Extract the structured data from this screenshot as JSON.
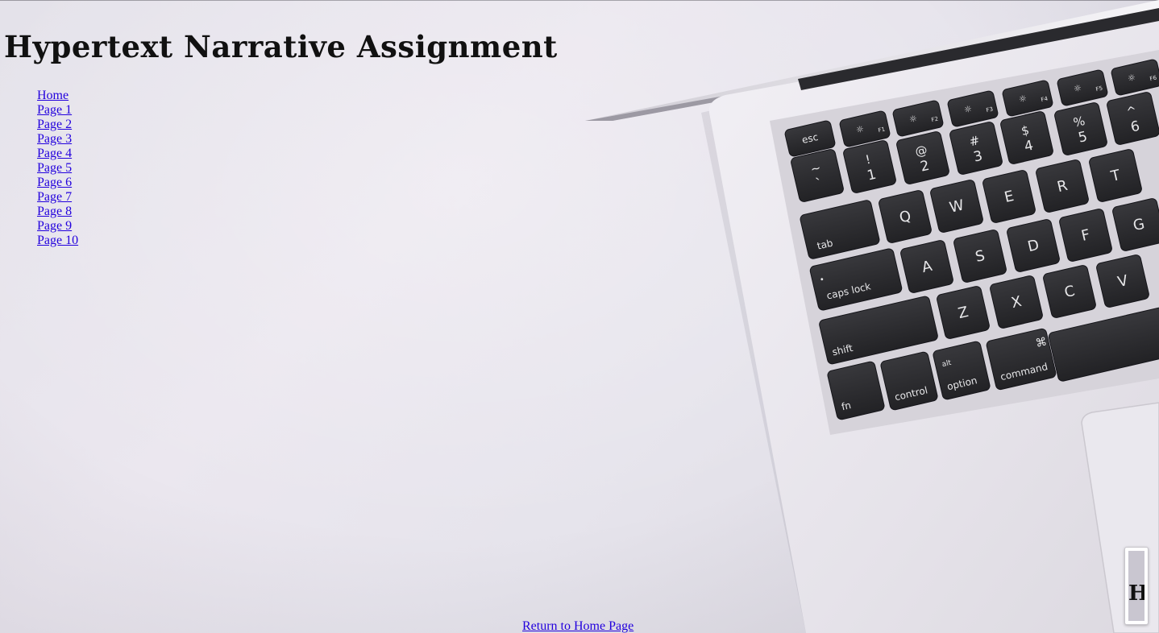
{
  "page": {
    "title": "Hypertext Narrative Assignment"
  },
  "nav": {
    "items": [
      {
        "label": "Home"
      },
      {
        "label": "Page 1"
      },
      {
        "label": "Page 2"
      },
      {
        "label": "Page 3"
      },
      {
        "label": "Page 4"
      },
      {
        "label": "Page 5"
      },
      {
        "label": "Page 6"
      },
      {
        "label": "Page 7"
      },
      {
        "label": "Page 8"
      },
      {
        "label": "Page 9"
      },
      {
        "label": "Page 10"
      }
    ]
  },
  "footer": {
    "return_label": "Return to Home Page"
  },
  "thumbnail": {
    "letter": "H"
  },
  "keyboard": {
    "fn_row": [
      "esc",
      "F1",
      "F2",
      "F3",
      "F4",
      "F5",
      "F6"
    ],
    "number_row": [
      {
        "top": "~",
        "bottom": "`"
      },
      {
        "top": "!",
        "bottom": "1"
      },
      {
        "top": "@",
        "bottom": "2"
      },
      {
        "top": "#",
        "bottom": "3"
      },
      {
        "top": "$",
        "bottom": "4"
      },
      {
        "top": "%",
        "bottom": "5"
      },
      {
        "top": "^",
        "bottom": "6"
      }
    ],
    "qwerty_row": [
      "tab",
      "Q",
      "W",
      "E",
      "R",
      "T"
    ],
    "home_row": [
      "caps lock",
      "A",
      "S",
      "D",
      "F",
      "G"
    ],
    "shift_row": [
      "shift",
      "Z",
      "X",
      "C",
      "V"
    ],
    "bottom_row": [
      {
        "label": "fn"
      },
      {
        "label": "control"
      },
      {
        "label": "option",
        "sub": "alt"
      },
      {
        "label": "command",
        "sub": "⌘"
      }
    ]
  },
  "colors": {
    "link": "#2200dd",
    "background": "#e8e5ed",
    "key": "#2a2a2d",
    "key_text": "#e8e8ea",
    "laptop_body": "#eceaf0"
  }
}
